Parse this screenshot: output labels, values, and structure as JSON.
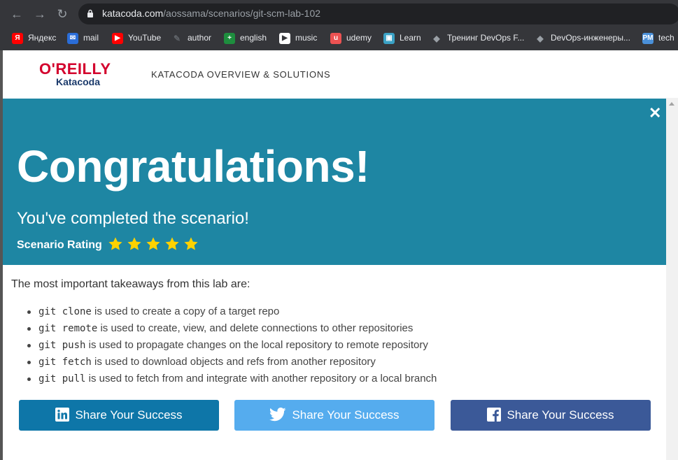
{
  "browser": {
    "url_host": "katacoda.com",
    "url_path": "/aossama/scenarios/git-scm-lab-102",
    "bookmarks": [
      {
        "label": "Яндекс",
        "icon": "yandex-icon",
        "color": "#ff0000",
        "glyph": "Я"
      },
      {
        "label": "mail",
        "icon": "mail-icon",
        "color": "#2a6dd8",
        "glyph": "✉"
      },
      {
        "label": "YouTube",
        "icon": "youtube-icon",
        "color": "#ff0000",
        "glyph": "▶"
      },
      {
        "label": "author",
        "icon": "author-icon",
        "color": "#5f6368",
        "glyph": "✎"
      },
      {
        "label": "english",
        "icon": "sheets-icon",
        "color": "#1e8e3e",
        "glyph": "+"
      },
      {
        "label": "music",
        "icon": "music-icon",
        "color": "#ffffff",
        "glyph": "▶"
      },
      {
        "label": "udemy",
        "icon": "udemy-icon",
        "color": "#ec5252",
        "glyph": "u"
      },
      {
        "label": "Learn",
        "icon": "learn-icon",
        "color": "#3aa1c4",
        "glyph": "▣"
      },
      {
        "label": "Тренинг DevOps F...",
        "icon": "graduation-cap-icon",
        "color": "#9aa0a6",
        "glyph": "◆"
      },
      {
        "label": "DevOps-инженеры...",
        "icon": "graduation-cap-icon",
        "color": "#9aa0a6",
        "glyph": "◆"
      },
      {
        "label": "tech",
        "icon": "pm-icon",
        "color": "#4a90d9",
        "glyph": "PM"
      }
    ]
  },
  "header": {
    "logo_oreilly": "O'REILLY",
    "logo_katacoda": "Katacoda",
    "nav_link": "KATACODA OVERVIEW & SOLUTIONS"
  },
  "banner": {
    "title": "Congratulations!",
    "subtitle": "You've completed the scenario!",
    "rating_label": "Scenario Rating",
    "rating": 5,
    "star_color": "#ffd200",
    "background": "#1e86a3"
  },
  "content": {
    "intro": "The most important takeaways from this lab are:",
    "takeaways": [
      {
        "code": "git clone",
        "text": " is used to create a copy of a target repo"
      },
      {
        "code": "git remote",
        "text": " is used to create, view, and delete connections to other repositories"
      },
      {
        "code": "git push",
        "text": " is used to propagate changes on the local repository to remote repository"
      },
      {
        "code": "git fetch",
        "text": " is used to download objects and refs from another repository"
      },
      {
        "code": "git pull",
        "text": " is used to fetch from and integrate with another repository or a local branch"
      }
    ]
  },
  "share": {
    "linkedin_label": "Share Your Success",
    "twitter_label": "Share Your Success",
    "facebook_label": "Share Your Success",
    "linkedin_color": "#0e76a8",
    "twitter_color": "#55acee",
    "facebook_color": "#3b5998"
  }
}
